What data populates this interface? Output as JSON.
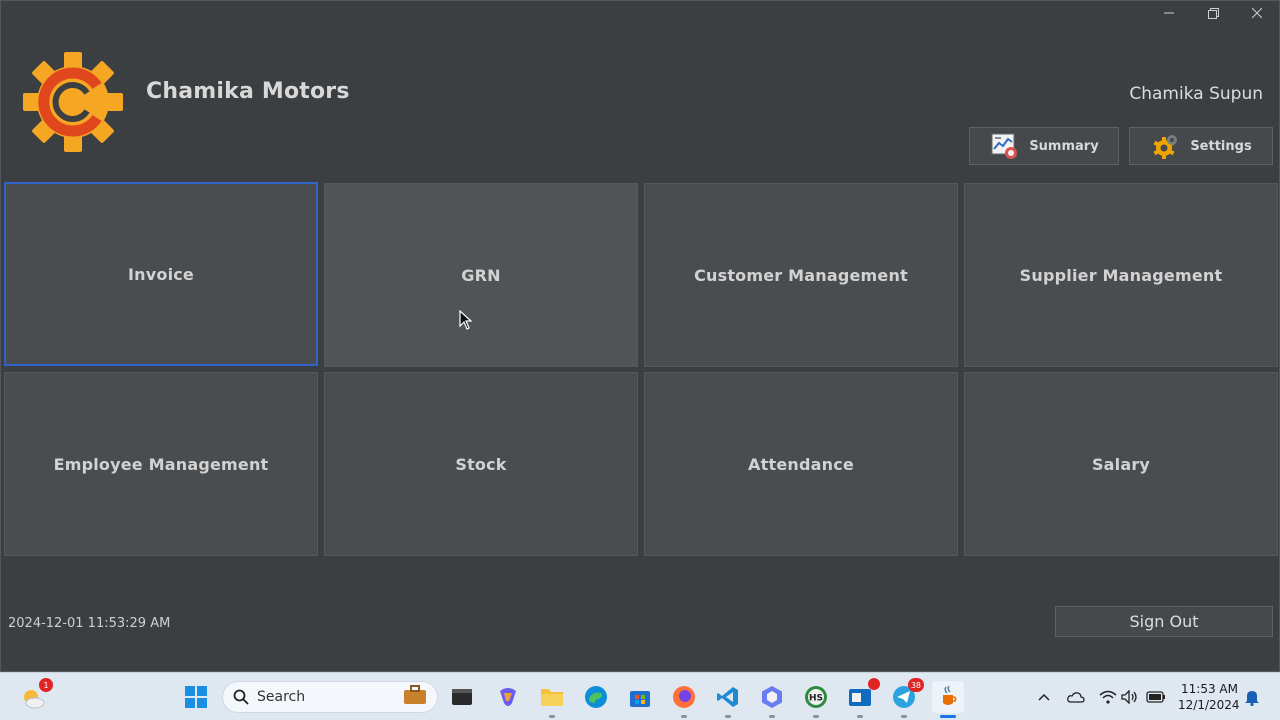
{
  "app": {
    "brand_name": "Chamika Motors",
    "user_name": "Chamika Supun",
    "header_buttons": {
      "summary_label": "Summary",
      "settings_label": "Settings"
    },
    "tiles": [
      {
        "label": "Invoice"
      },
      {
        "label": "GRN"
      },
      {
        "label": "Customer Management"
      },
      {
        "label": "Supplier Management"
      },
      {
        "label": "Employee Management"
      },
      {
        "label": "Stock"
      },
      {
        "label": "Attendance"
      },
      {
        "label": "Salary"
      }
    ],
    "timestamp": "2024-12-01 11:53:29 AM",
    "sign_out_label": "Sign Out",
    "colors": {
      "background": "#3c3f41",
      "tile": "#4a4d50",
      "focus_border": "#2f65ca",
      "logo_gear": "#f5a623",
      "logo_letter": "#e0471c"
    }
  },
  "taskbar": {
    "search_placeholder": "Search",
    "weather_badge": "1",
    "telegram_badge": "38",
    "time": "11:53 AM",
    "date": "12/1/2024",
    "pinned_icons": [
      "widgets-weather-icon",
      "windows-start-icon",
      "search-icon",
      "work-briefcase-icon",
      "terminal-icon",
      "copilot-icon",
      "file-explorer-icon",
      "edge-icon",
      "store-icon",
      "firefox-icon",
      "vscode-icon",
      "hexagon-app-icon",
      "hs-app-icon",
      "outlook-icon",
      "telegram-icon",
      "java-app-icon"
    ]
  }
}
